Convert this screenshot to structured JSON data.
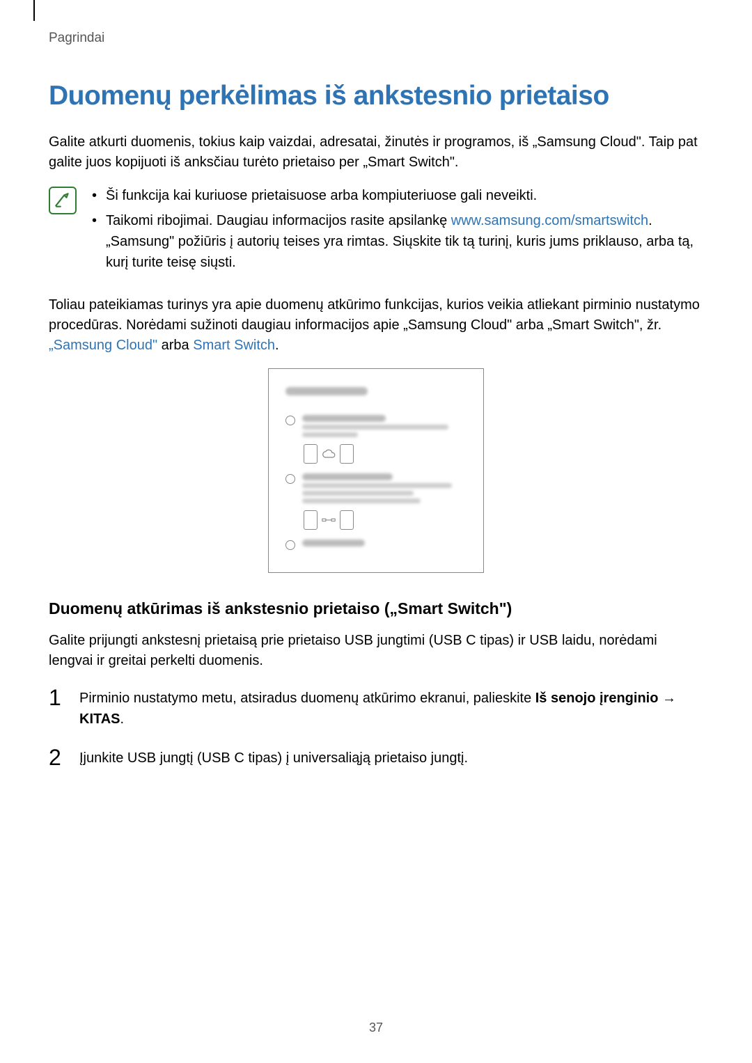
{
  "header": {
    "section": "Pagrindai"
  },
  "title": "Duomenų perkėlimas iš ankstesnio prietaiso",
  "intro": "Galite atkurti duomenis, tokius kaip vaizdai, adresatai, žinutės ir programos, iš „Samsung Cloud\". Taip pat galite juos kopijuoti iš anksčiau turėto prietaiso per „Smart Switch\".",
  "note": {
    "bullet1": "Ši funkcija kai kuriuose prietaisuose arba kompiuteriuose gali neveikti.",
    "bullet2_a": "Taikomi ribojimai. Daugiau informacijos rasite apsilankę ",
    "bullet2_link": "www.samsung.com/smartswitch",
    "bullet2_b": ". „Samsung\" požiūris į autorių teises yra rimtas. Siųskite tik tą turinį, kuris jums priklauso, arba tą, kurį turite teisę siųsti."
  },
  "para2_a": "Toliau pateikiamas turinys yra apie duomenų atkūrimo funkcijas, kurios veikia atliekant pirminio nustatymo procedūras. Norėdami sužinoti daugiau informacijos apie „Samsung Cloud\" arba „Smart Switch\", žr. ",
  "para2_link1": "„Samsung Cloud\"",
  "para2_mid": " arba ",
  "para2_link2": "Smart Switch",
  "para2_end": ".",
  "subheading": "Duomenų atkūrimas iš ankstesnio prietaiso („Smart Switch\")",
  "sub_intro": "Galite prijungti ankstesnį prietaisą prie prietaiso USB jungtimi (USB C tipas) ir USB laidu, norėdami lengvai ir greitai perkelti duomenis.",
  "steps": {
    "s1_num": "1",
    "s1_a": "Pirminio nustatymo metu, atsiradus duomenų atkūrimo ekranui, palieskite ",
    "s1_bold": "Iš senojo įrenginio",
    "s1_arrow": " → ",
    "s1_bold2": "KITAS",
    "s1_end": ".",
    "s2_num": "2",
    "s2": "Įjunkite USB jungtį (USB C tipas) į universaliąją prietaiso jungtį."
  },
  "page_number": "37"
}
